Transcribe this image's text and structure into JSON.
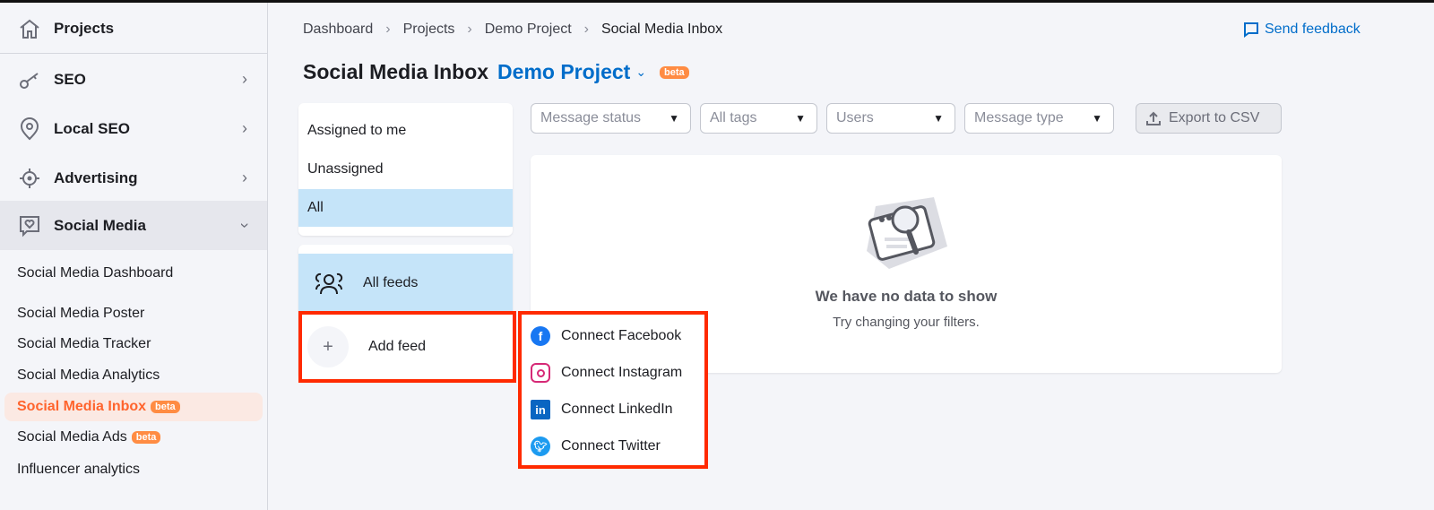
{
  "sidebar": {
    "projects": "Projects",
    "items": [
      {
        "label": "SEO",
        "icon": "key-icon"
      },
      {
        "label": "Local SEO",
        "icon": "location-pin-icon"
      },
      {
        "label": "Advertising",
        "icon": "crosshair-icon"
      },
      {
        "label": "Social Media",
        "icon": "chat-heart-icon",
        "expanded": true
      }
    ],
    "sub_items": [
      {
        "label": "Social Media Dashboard"
      },
      {
        "label": "Social Media Poster"
      },
      {
        "label": "Social Media Tracker"
      },
      {
        "label": "Social Media Analytics"
      },
      {
        "label": "Social Media Inbox",
        "badge": "beta",
        "active": true
      },
      {
        "label": "Social Media Ads",
        "badge": "beta"
      },
      {
        "label": "Influencer analytics"
      }
    ]
  },
  "breadcrumb": [
    "Dashboard",
    "Projects",
    "Demo Project",
    "Social Media Inbox"
  ],
  "feedback": "Send feedback",
  "header": {
    "title": "Social Media Inbox",
    "project": "Demo Project",
    "badge": "beta"
  },
  "assign_filters": [
    "Assigned to me",
    "Unassigned",
    "All"
  ],
  "feeds": {
    "all": "All feeds",
    "add": "Add feed"
  },
  "filters": {
    "status": "Message status",
    "tags": "All tags",
    "users": "Users",
    "type": "Message type",
    "export": "Export to CSV"
  },
  "empty": {
    "title": "We have no data to show",
    "subtitle": "Try changing your filters."
  },
  "connect_menu": [
    {
      "label": "Connect Facebook",
      "color": "#1877f2"
    },
    {
      "label": "Connect Instagram",
      "color": "#d62976"
    },
    {
      "label": "Connect LinkedIn",
      "color": "#0a66c2"
    },
    {
      "label": "Connect Twitter",
      "color": "#1d9bf0"
    }
  ],
  "colors": {
    "accent": "#ff642d",
    "link": "#006dca",
    "selected": "#c5e4f9",
    "highlight": "#ff2a00"
  }
}
